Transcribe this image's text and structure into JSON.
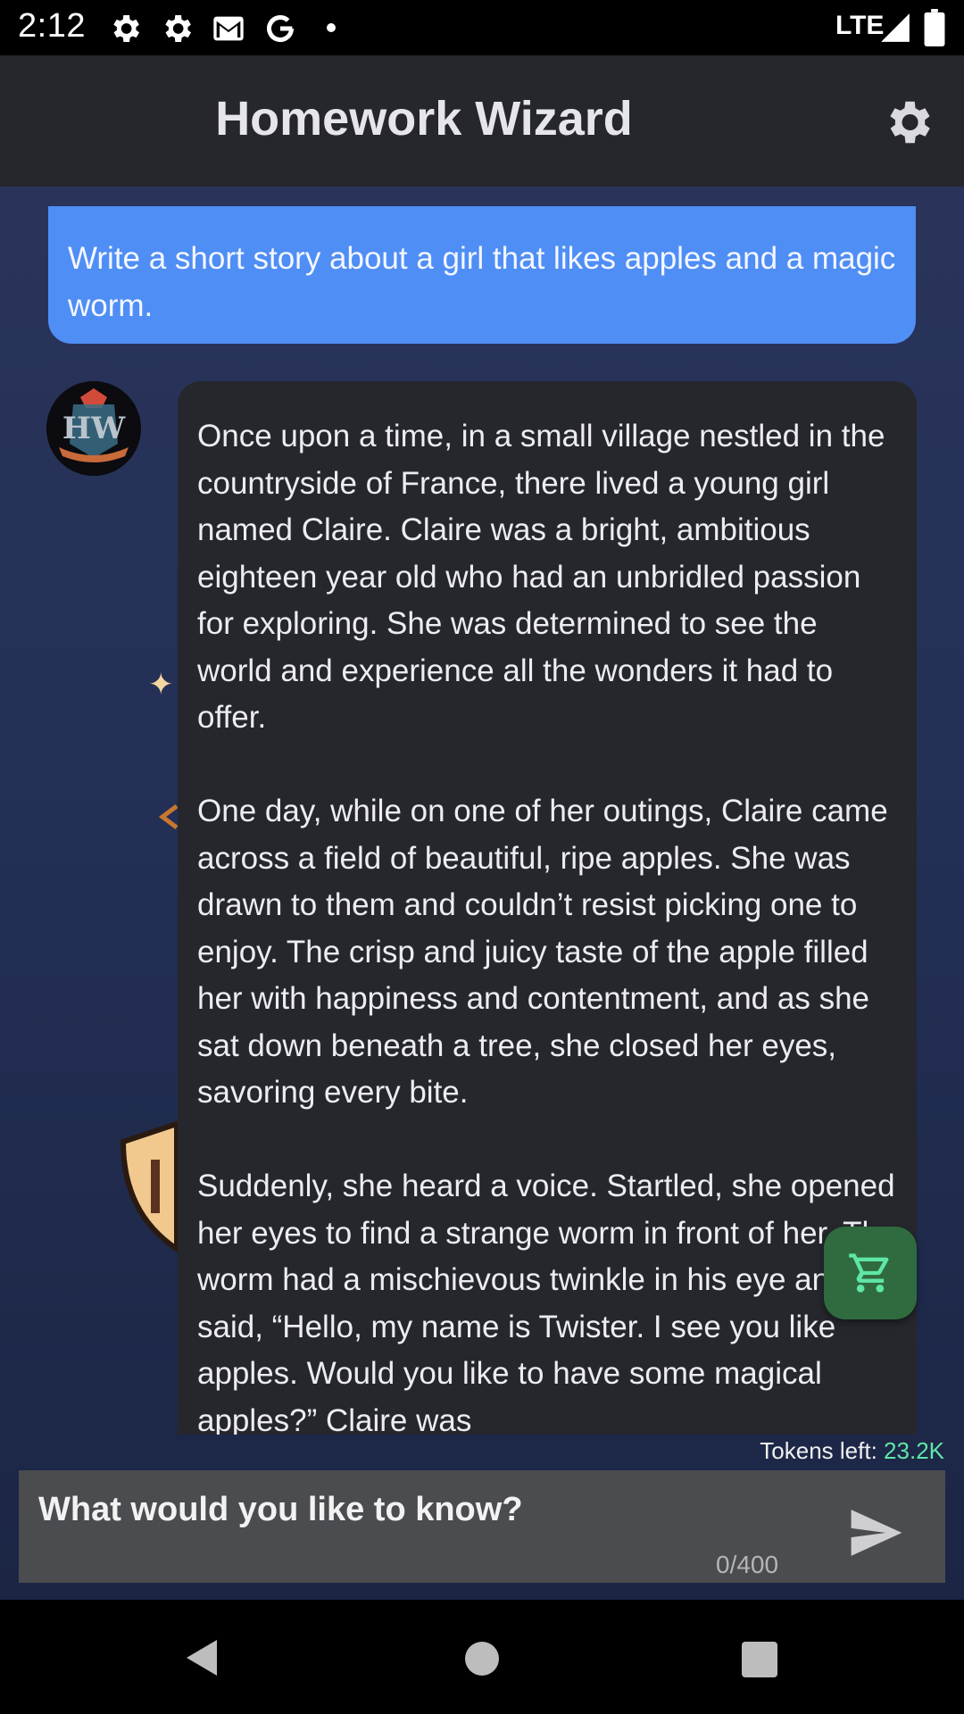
{
  "status_bar": {
    "time": "2:12",
    "network": "LTE",
    "icons": [
      "settings-icon",
      "settings-icon",
      "gmail-icon",
      "google-icon",
      "dot-icon",
      "signal-icon",
      "battery-icon"
    ]
  },
  "app_bar": {
    "title": "Homework Wizard",
    "settings_icon": "gear-icon"
  },
  "chat": {
    "user_message": "Write a short story about a girl that likes apples and a magic worm.",
    "bot_avatar_label": "Homework Wizard",
    "bot_message_paragraphs": [
      "Once upon a time, in a small village nestled in the countryside of France, there lived a young girl named Claire. Claire was a bright, ambitious eighteen year old who had an unbridled passion for exploring. She was determined to see the world and experience all the wonders it had to offer.",
      "One day, while on one of her outings, Claire came across a field of beautiful, ripe apples. She was drawn to them and couldn’t resist picking one to enjoy. The crisp and juicy taste of the apple filled her with happiness and contentment, and as she sat down beneath a tree, she closed her eyes, savoring every bite.",
      "Suddenly, she heard a voice. Startled, she opened her eyes to find a strange worm in front of her. The worm had a mischievous twinkle in his eye and said, “Hello, my name is Twister. I see you like apples. Would you like to have some magical apples?” Claire was"
    ]
  },
  "store": {
    "icon": "cart-icon"
  },
  "tokens": {
    "label": "Tokens left:",
    "value": "23.2K"
  },
  "input": {
    "placeholder": "What would you like to know?",
    "value": "",
    "counter": "0/400",
    "send_icon": "send-icon"
  },
  "colors": {
    "user_bubble": "#4f8ef5",
    "bot_bubble": "#25272d",
    "app_bar": "#25272d",
    "tokens_value": "#5fe6a6",
    "cart_button": "#2f6b3e"
  }
}
